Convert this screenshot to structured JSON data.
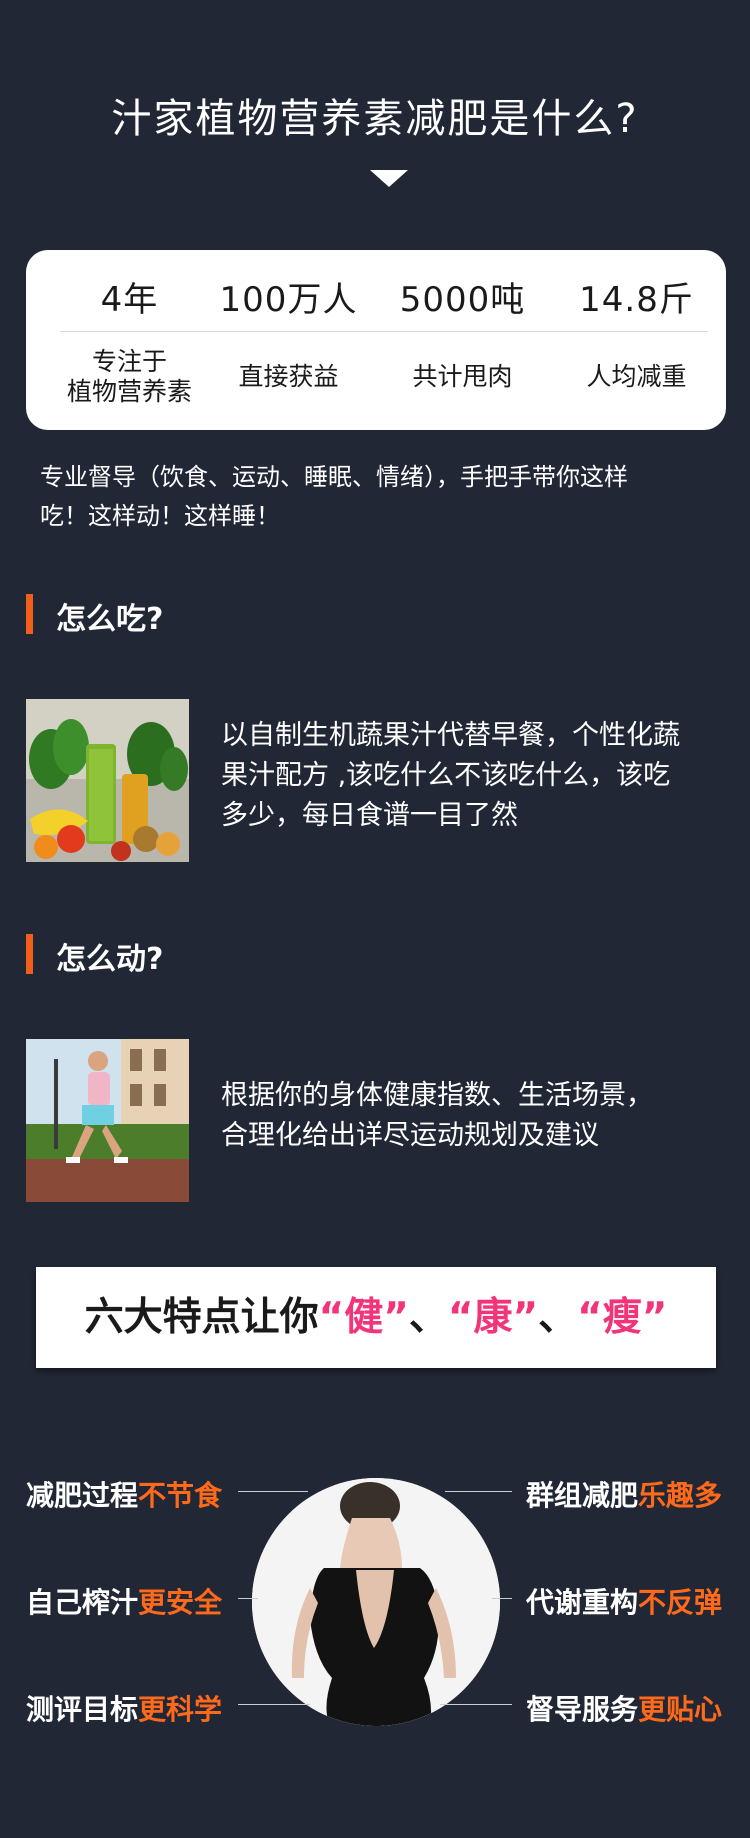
{
  "page": {
    "title": "汁家植物营养素减肥是什么?"
  },
  "stats": [
    {
      "value": "4年",
      "label_line1": "专注于",
      "label_line2": "植物营养素"
    },
    {
      "value": "100万人",
      "label_line1": "直接获益",
      "label_line2": ""
    },
    {
      "value": "5000吨",
      "label_line1": "共计甩肉",
      "label_line2": ""
    },
    {
      "value": "14.8斤",
      "label_line1": "人均减重",
      "label_line2": ""
    }
  ],
  "intro": {
    "line1": "专业督导（饮食、运动、睡眠、情绪），手把手带你这样",
    "line2": "吃！这样动！这样睡！"
  },
  "eat": {
    "heading": "怎么吃?",
    "image": "fruits-vegetables-juice-photo",
    "line1": "以自制生机蔬果汁代替早餐，个性化蔬",
    "line2": "果汁配方 ,该吃什么不该吃什么，该吃",
    "line3": "多少，每日食谱一目了然"
  },
  "move": {
    "heading": "怎么动?",
    "image": "man-jogging-photo",
    "line1": "根据你的身体健康指数、生活场景，",
    "line2": "合理化给出详尽运动规划及建议"
  },
  "banner": {
    "prefix": "六大特点让你",
    "w1": "“健”",
    "sep1": "、",
    "w2": "“康”",
    "sep2": "、",
    "w3": "“瘦”"
  },
  "features": {
    "image": "slim-woman-back-photo",
    "left": [
      {
        "a": "减肥过程",
        "b": "不节食"
      },
      {
        "a": "自己榨汁",
        "b": "更安全"
      },
      {
        "a": "测评目标",
        "b": "更科学"
      }
    ],
    "right": [
      {
        "a": "群组减肥",
        "b": "乐趣多"
      },
      {
        "a": "代谢重构",
        "b": "不反弹"
      },
      {
        "a": "督导服务",
        "b": "更贴心"
      }
    ]
  },
  "colors": {
    "background": "#222736",
    "accent_orange": "#ff6a1a",
    "accent_pink": "#f2357b",
    "section_bar": "#f25f1c"
  }
}
